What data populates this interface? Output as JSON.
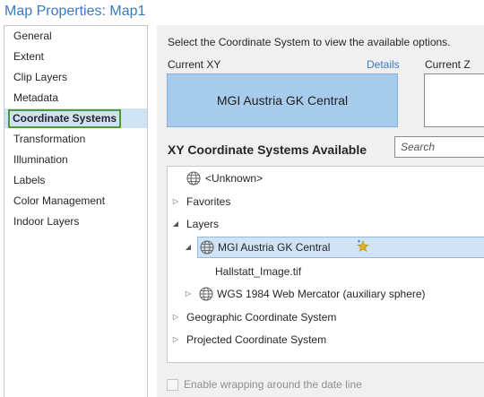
{
  "window": {
    "title": "Map Properties: Map1"
  },
  "sidebar": {
    "items": [
      {
        "label": "General"
      },
      {
        "label": "Extent"
      },
      {
        "label": "Clip Layers"
      },
      {
        "label": "Metadata"
      },
      {
        "label": "Coordinate Systems",
        "selected": true
      },
      {
        "label": "Transformation"
      },
      {
        "label": "Illumination"
      },
      {
        "label": "Labels"
      },
      {
        "label": "Color Management"
      },
      {
        "label": "Indoor Layers"
      }
    ]
  },
  "main": {
    "instruction": "Select the Coordinate System to view the available options.",
    "current_xy_label": "Current XY",
    "details_link": "Details",
    "current_z_label": "Current Z",
    "current_xy_value": "MGI Austria GK Central",
    "available_heading": "XY Coordinate Systems Available",
    "search_placeholder": "Search",
    "tree": [
      {
        "label": "<Unknown>",
        "icon": "globe-icon",
        "caret": ""
      },
      {
        "label": "Favorites",
        "icon": "",
        "caret": "collapsed"
      },
      {
        "label": "Layers",
        "icon": "",
        "caret": "expanded"
      },
      {
        "label": "MGI Austria GK Central",
        "icon": "globe-icon",
        "caret": "expanded",
        "selected": true,
        "favorite_icon": "star-add-icon"
      },
      {
        "label": "Hallstatt_Image.tif",
        "icon": "",
        "caret": ""
      },
      {
        "label": "WGS 1984 Web Mercator (auxiliary sphere)",
        "icon": "globe-icon",
        "caret": "collapsed"
      },
      {
        "label": "Geographic Coordinate System",
        "icon": "",
        "caret": "collapsed"
      },
      {
        "label": "Projected Coordinate System",
        "icon": "",
        "caret": "collapsed"
      }
    ],
    "wrap_label": "Enable wrapping around the date line"
  },
  "colors": {
    "accent": "#3b7abf",
    "selection": "#cfe3f5",
    "current_xy_fill": "#a7cbeb",
    "highlight_border": "#4f9a34"
  }
}
